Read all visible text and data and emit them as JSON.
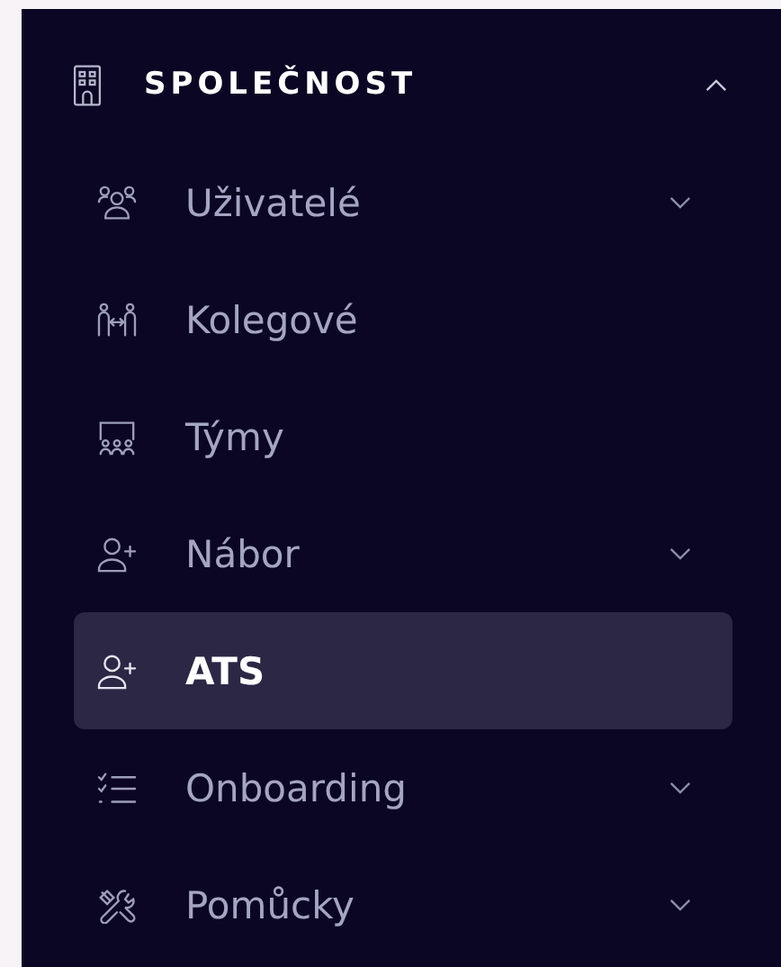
{
  "section": {
    "title": "SPOLEČNOST",
    "expanded": true,
    "items": [
      {
        "label": "Uživatelé",
        "expandable": true,
        "selected": false
      },
      {
        "label": "Kolegové",
        "expandable": false,
        "selected": false
      },
      {
        "label": "Týmy",
        "expandable": false,
        "selected": false
      },
      {
        "label": "Nábor",
        "expandable": true,
        "selected": false
      },
      {
        "label": "ATS",
        "expandable": false,
        "selected": true
      },
      {
        "label": "Onboarding",
        "expandable": true,
        "selected": false
      },
      {
        "label": "Pomůcky",
        "expandable": true,
        "selected": false
      }
    ]
  }
}
